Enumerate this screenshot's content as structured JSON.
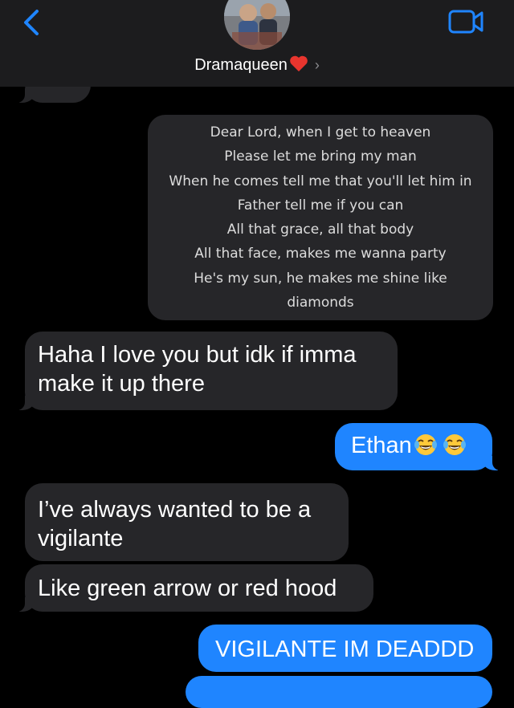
{
  "header": {
    "contact_name": "Dramaqueen",
    "contact_chevron": "›"
  },
  "messages": {
    "lyrics_lines": [
      "Dear Lord, when I get to heaven",
      "Please let me bring my man",
      "When he comes tell me that you'll let him in",
      "Father tell me if you can",
      "All that grace, all that body",
      "All that face, makes me wanna party",
      "He's my sun, he makes me shine like",
      "diamonds"
    ],
    "haha_line1": "Haha I love you but idk if imma",
    "haha_line2": "make it up there",
    "ethan": "Ethan",
    "vigilante_line1": "I’ve always wanted to be a",
    "vigilante_line2": "vigilante",
    "green_arrow": "Like green arrow or red hood",
    "dead": "VIGILANTE IM DEADDD"
  },
  "colors": {
    "received_bubble": "#262629",
    "sent_bubble": "#1f85ff",
    "header_bg": "#1c1c1e",
    "accent": "#1f85ff"
  },
  "icons": [
    "back-chevron-icon",
    "video-camera-icon",
    "heart-icon",
    "laughing-tears-emoji"
  ]
}
